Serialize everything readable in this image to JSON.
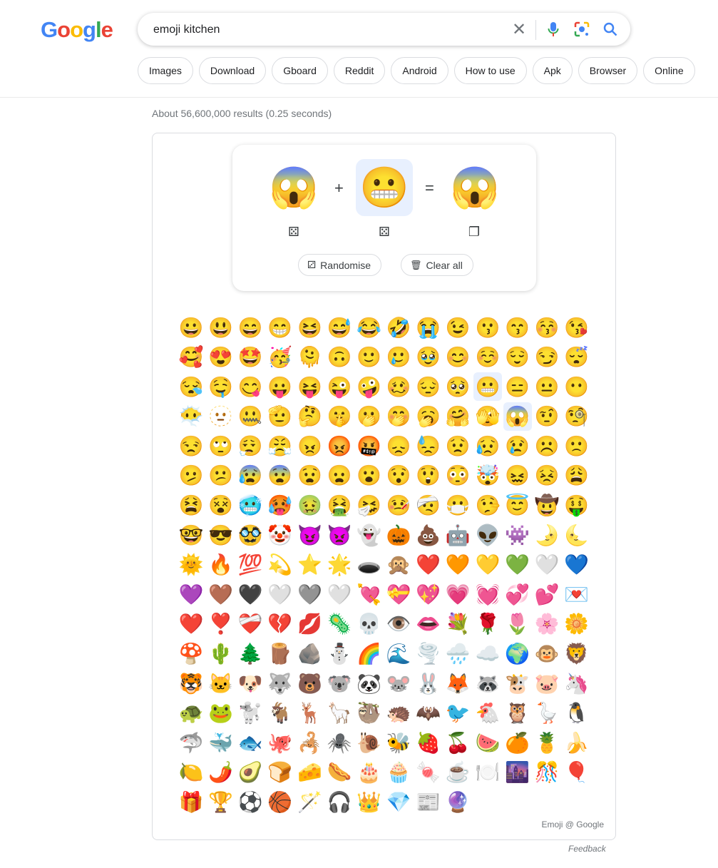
{
  "logo": {
    "letters": [
      "G",
      "o",
      "o",
      "g",
      "l",
      "e"
    ],
    "colors": [
      "#4285f4",
      "#ea4335",
      "#fbbc05",
      "#4285f4",
      "#34a853",
      "#ea4335"
    ]
  },
  "search": {
    "value": "emoji kitchen",
    "clear_icon": "close-icon",
    "mic_icon": "mic-icon",
    "lens_icon": "lens-icon",
    "search_icon": "search-icon"
  },
  "chips": [
    "Images",
    "Download",
    "Gboard",
    "Reddit",
    "Android",
    "How to use",
    "Apk",
    "Browser",
    "Online"
  ],
  "stats": "About 56,600,000 results (0.25 seconds)",
  "mixer": {
    "left": "😱",
    "plus": "+",
    "right": "😬",
    "equals": "=",
    "result": "😱",
    "randomise": "Randomise",
    "clear_all": "Clear all"
  },
  "emoji_rows": [
    [
      "😀",
      "😃",
      "😄",
      "😁",
      "😆",
      "😅",
      "😂",
      "🤣",
      "😭",
      "😉",
      "😗",
      "😙",
      "😚",
      "😘"
    ],
    [
      "🥰",
      "😍",
      "🤩",
      "🥳",
      "🫠",
      "🙃",
      "🙂",
      "🥲",
      "🥹",
      "😊",
      "☺️",
      "😌",
      "😏",
      "😴"
    ],
    [
      "😪",
      "🤤",
      "😋",
      "😛",
      "😝",
      "😜",
      "🤪",
      "🥴",
      "😔",
      "🥺",
      "😬",
      "😑",
      "😐",
      "😶"
    ],
    [
      "😶‍🌫️",
      "🫥",
      "🤐",
      "🫡",
      "🤔",
      "🤫",
      "🫢",
      "🤭",
      "🥱",
      "🤗",
      "🫣",
      "😱",
      "🤨",
      "🧐"
    ],
    [
      "😒",
      "🙄",
      "😮‍💨",
      "😤",
      "😠",
      "😡",
      "🤬",
      "😞",
      "😓",
      "😟",
      "😥",
      "😢",
      "☹️",
      "🙁"
    ],
    [
      "🫤",
      "😕",
      "😰",
      "😨",
      "😧",
      "😦",
      "😮",
      "😯",
      "😲",
      "😳",
      "🤯",
      "😖",
      "😣",
      "😩"
    ],
    [
      "😫",
      "😵",
      "🥶",
      "🥵",
      "🤢",
      "🤮",
      "🤧",
      "🤒",
      "🤕",
      "😷",
      "🤥",
      "😇",
      "🤠",
      "🤑"
    ],
    [
      "🤓",
      "😎",
      "🥸",
      "🤡",
      "😈",
      "👿",
      "👻",
      "🎃",
      "💩",
      "🤖",
      "👽",
      "👾",
      "🌛",
      "🌜"
    ],
    [
      "🌞",
      "🔥",
      "💯",
      "💫",
      "⭐",
      "🌟",
      "🕳️",
      "🙊",
      "❤️",
      "🧡",
      "💛",
      "💚",
      "🤍",
      "💙"
    ],
    [
      "💜",
      "🤎",
      "🖤",
      "🤍",
      "🩶",
      "🤍",
      "💘",
      "💝",
      "💖",
      "💗",
      "💓",
      "💞",
      "💕",
      "💌"
    ],
    [
      "❤️",
      "❣️",
      "❤️‍🩹",
      "💔",
      "💋",
      "🦠",
      "💀",
      "👁️",
      "👄",
      "💐",
      "🌹",
      "🌷",
      "🌸",
      "🌼"
    ],
    [
      "🍄",
      "🌵",
      "🌲",
      "🪵",
      "🪨",
      "⛄",
      "🌈",
      "🌊",
      "🌪️",
      "🌧️",
      "☁️",
      "🌍",
      "🐵",
      "🦁"
    ],
    [
      "🐯",
      "🐱",
      "🐶",
      "🐺",
      "🐻",
      "🐨",
      "🐼",
      "🐭",
      "🐰",
      "🦊",
      "🦝",
      "🐮",
      "🐷",
      "🦄"
    ],
    [
      "🐢",
      "🐸",
      "🐩",
      "🐐",
      "🦌",
      "🦙",
      "🦥",
      "🦔",
      "🦇",
      "🐦",
      "🐔",
      "🦉",
      "🪿",
      "🐧"
    ],
    [
      "🦈",
      "🐳",
      "🐟",
      "🐙",
      "🦂",
      "🕷️",
      "🐌",
      "🐝",
      "🍓",
      "🍒",
      "🍉",
      "🍊",
      "🍍",
      "🍌"
    ],
    [
      "🍋",
      "🌶️",
      "🥑",
      "🍞",
      "🧀",
      "🌭",
      "🎂",
      "🧁",
      "🍬",
      "☕",
      "🍽️",
      "🌆",
      "🎊",
      "🎈"
    ],
    [
      "🎁",
      "🏆",
      "⚽",
      "🏀",
      "🪄",
      "🎧",
      "👑",
      "💎",
      "📰",
      "🔮"
    ]
  ],
  "selected": [
    "😬",
    "😱"
  ],
  "credit": "Emoji @ Google",
  "feedback": "Feedback",
  "colors": {
    "accent": "#1a73e8",
    "selected_bg": "#e8f0fe"
  }
}
